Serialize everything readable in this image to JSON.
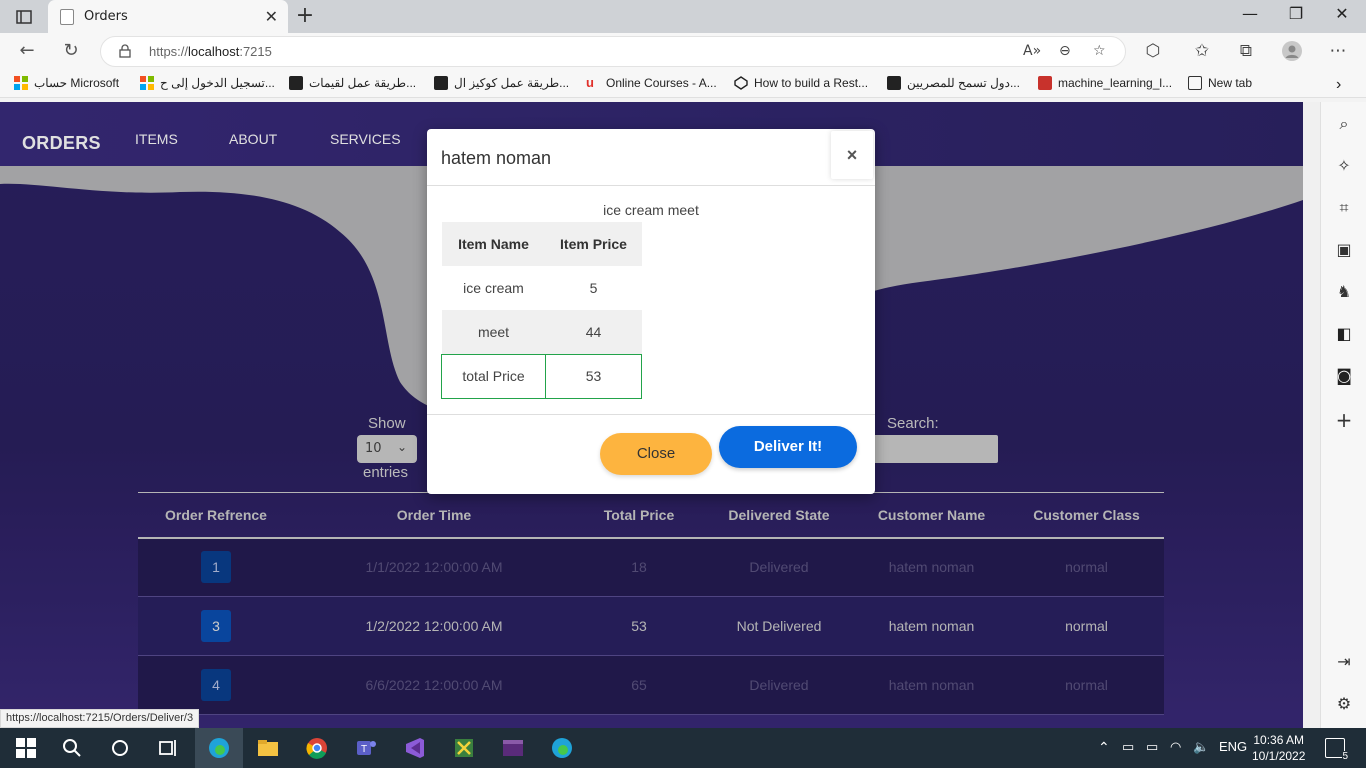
{
  "browser": {
    "tab_title": "Orders",
    "url_scheme": "https://",
    "url_host": "localhost",
    "url_rest": ":7215",
    "status_link": "https://localhost:7215/Orders/Deliver/3",
    "bookmarks": [
      {
        "label": "حساب Microsoft",
        "icon": "microsoft-logo-icon"
      },
      {
        "label": "تسجيل الدخول إلى ح...",
        "icon": "microsoft-logo-icon"
      },
      {
        "label": "طريقة عمل لقيمات...",
        "icon": "bookmark-site-icon"
      },
      {
        "label": "طريقة عمل كوكيز ال...",
        "icon": "bookmark-site-icon"
      },
      {
        "label": "Online Courses - A...",
        "icon": "udemy-icon"
      },
      {
        "label": "How to build a Rest...",
        "icon": "codepen-icon"
      },
      {
        "label": "دول تسمح للمصريين...",
        "icon": "bookmark-site-icon"
      },
      {
        "label": "machine_learning_l...",
        "icon": "pdf-icon"
      },
      {
        "label": "New tab",
        "icon": "new-tab-icon"
      }
    ]
  },
  "page": {
    "brand": "ORDERS",
    "nav": [
      "ITEMS",
      "ABOUT",
      "SERVICES"
    ],
    "show_label": "Show",
    "entries_label": "entries",
    "length_value": "10",
    "search_label": "Search:",
    "table": {
      "headers": [
        "Order Refrence",
        "Order Time",
        "Total Price",
        "Delivered State",
        "Customer Name",
        "Customer Class"
      ],
      "rows": [
        {
          "ref": "1",
          "time": "1/1/2022 12:00:00 AM",
          "price": "18",
          "state": "Delivered",
          "customer": "hatem noman",
          "class": "normal"
        },
        {
          "ref": "3",
          "time": "1/2/2022 12:00:00 AM",
          "price": "53",
          "state": "Not Delivered",
          "customer": "hatem noman",
          "class": "normal"
        },
        {
          "ref": "4",
          "time": "6/6/2022 12:00:00 AM",
          "price": "65",
          "state": "Delivered",
          "customer": "hatem noman",
          "class": "normal"
        }
      ]
    }
  },
  "modal": {
    "title": "hatem noman",
    "caption": "ice cream meet",
    "col_name": "Item Name",
    "col_price": "Item Price",
    "items": [
      {
        "name": "ice cream",
        "price": "5"
      },
      {
        "name": "meet",
        "price": "44"
      }
    ],
    "total_label": "total Price",
    "total_value": "53",
    "close_label": "Close",
    "deliver_label": "Deliver It!"
  },
  "taskbar": {
    "lang": "ENG",
    "time": "10:36 AM",
    "date": "10/1/2022",
    "notifications": "5"
  },
  "colors": {
    "page_bg": "#2b2060",
    "modal_close": "#fdb43f",
    "modal_deliver": "#0b6bdf",
    "total_border": "#22a34a",
    "ref_button": "#0b4fb3"
  }
}
